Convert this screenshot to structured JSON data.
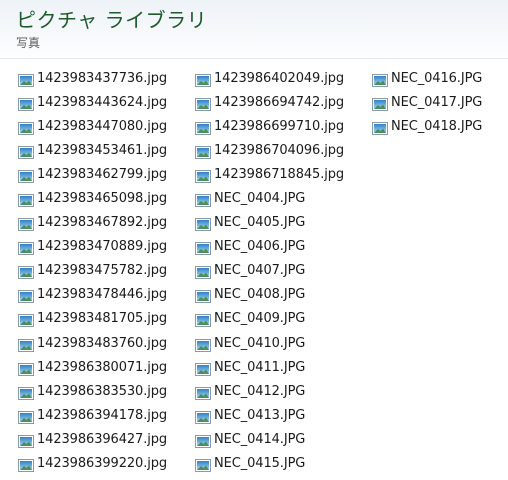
{
  "header": {
    "title": "ピクチャ ライブラリ",
    "subtitle": "写真"
  },
  "files": {
    "icon": "image-file-icon",
    "columns": [
      [
        "1423983437736.jpg",
        "1423983443624.jpg",
        "1423983447080.jpg",
        "1423983453461.jpg",
        "1423983462799.jpg",
        "1423983465098.jpg",
        "1423983467892.jpg",
        "1423983470889.jpg",
        "1423983475782.jpg",
        "1423983478446.jpg",
        "1423983481705.jpg",
        "1423983483760.jpg",
        "1423986380071.jpg",
        "1423986383530.jpg",
        "1423986394178.jpg",
        "1423986396427.jpg",
        "1423986399220.jpg"
      ],
      [
        "1423986402049.jpg",
        "1423986694742.jpg",
        "1423986699710.jpg",
        "1423986704096.jpg",
        "1423986718845.jpg",
        "NEC_0404.JPG",
        "NEC_0405.JPG",
        "NEC_0406.JPG",
        "NEC_0407.JPG",
        "NEC_0408.JPG",
        "NEC_0409.JPG",
        "NEC_0410.JPG",
        "NEC_0411.JPG",
        "NEC_0412.JPG",
        "NEC_0413.JPG",
        "NEC_0414.JPG",
        "NEC_0415.JPG"
      ],
      [
        "NEC_0416.JPG",
        "NEC_0417.JPG",
        "NEC_0418.JPG"
      ]
    ]
  }
}
